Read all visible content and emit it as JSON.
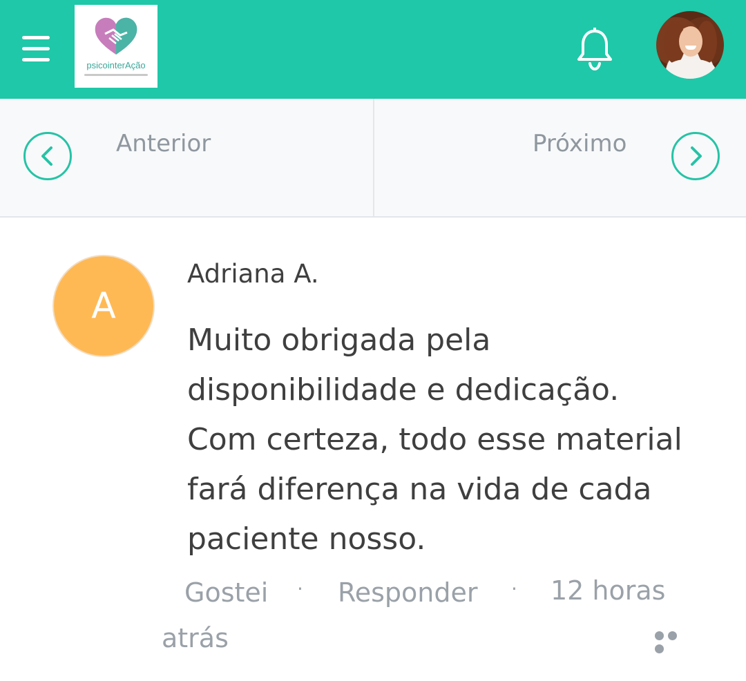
{
  "header": {
    "menu_icon": "hamburger-icon",
    "logo_text": "psicointerAção",
    "notification_icon": "bell-icon",
    "accent_color": "#1ec8a8"
  },
  "navigation": {
    "previous_label": "Anterior",
    "next_label": "Próximo"
  },
  "comment": {
    "avatar_initial": "A",
    "avatar_color": "#ffb954",
    "author": "Adriana A.",
    "text_lines": [
      "Muito obrigada pela",
      "disponibilidade e dedicação.",
      "Com certeza, todo esse material",
      "fará diferença na vida de cada",
      "paciente nosso."
    ],
    "like_label": "Gostei",
    "separator": "·",
    "reply_label": "Responder",
    "timestamp_line1": "12 horas",
    "timestamp_line2": "atrás",
    "more_icon": "more-options-icon"
  }
}
